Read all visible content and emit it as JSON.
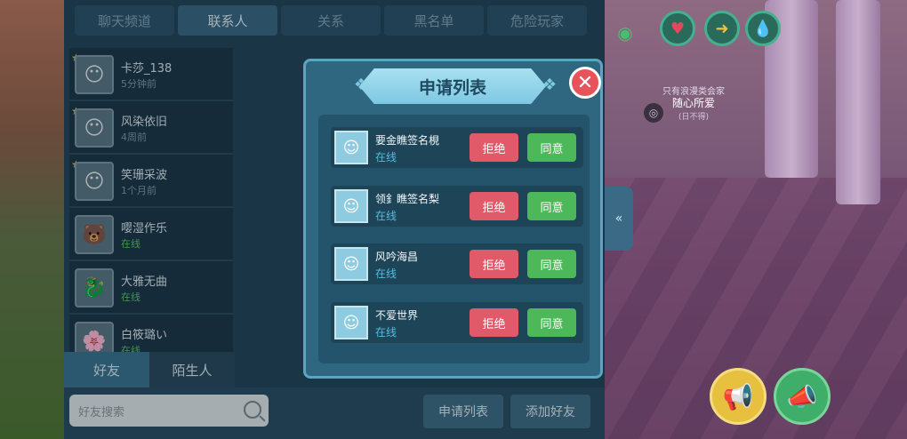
{
  "top_tabs": [
    "聊天频道",
    "联系人",
    "关系",
    "黑名单",
    "危险玩家"
  ],
  "friends": [
    {
      "name": "卡莎_138",
      "status": "5分钟前",
      "online": false,
      "starred": true,
      "avatar": "😶"
    },
    {
      "name": "风染依旧",
      "status": "4周前",
      "online": false,
      "starred": true,
      "avatar": "😶"
    },
    {
      "name": "笑珊采波",
      "status": "1个月前",
      "online": false,
      "starred": true,
      "avatar": "😶"
    },
    {
      "name": "嘤湿作乐",
      "status": "在线",
      "online": true,
      "starred": false,
      "avatar": "🐻"
    },
    {
      "name": "大雅无曲",
      "status": "在线",
      "online": true,
      "starred": false,
      "avatar": "🐉"
    },
    {
      "name": "白筱璐い",
      "status": "在线",
      "online": true,
      "starred": false,
      "avatar": "🌸"
    }
  ],
  "bottom_tabs": {
    "friends": "好友",
    "strangers": "陌生人"
  },
  "search": {
    "placeholder": "好友搜索"
  },
  "footer": {
    "request_list": "申请列表",
    "add_friend": "添加好友"
  },
  "collapse_icon": "«",
  "modal": {
    "title": "申请列表",
    "close_icon": "✕",
    "reject_label": "拒绝",
    "accept_label": "同意",
    "requests": [
      {
        "name": "要金瞧签名梘",
        "status": "在线"
      },
      {
        "name": "领釒瞧签名梨",
        "status": "在线"
      },
      {
        "name": "风吟海昌",
        "status": "在线"
      },
      {
        "name": "不爱世界",
        "status": "在线"
      }
    ]
  },
  "hud": {
    "npc_title": "只有浪漫类会家",
    "npc_name": "随心所爱",
    "npc_sub": "(日不得)"
  },
  "colors": {
    "accent": "#3a6a86",
    "reject": "#e05a6a",
    "accept": "#4cb85a",
    "online": "#58c86a"
  }
}
